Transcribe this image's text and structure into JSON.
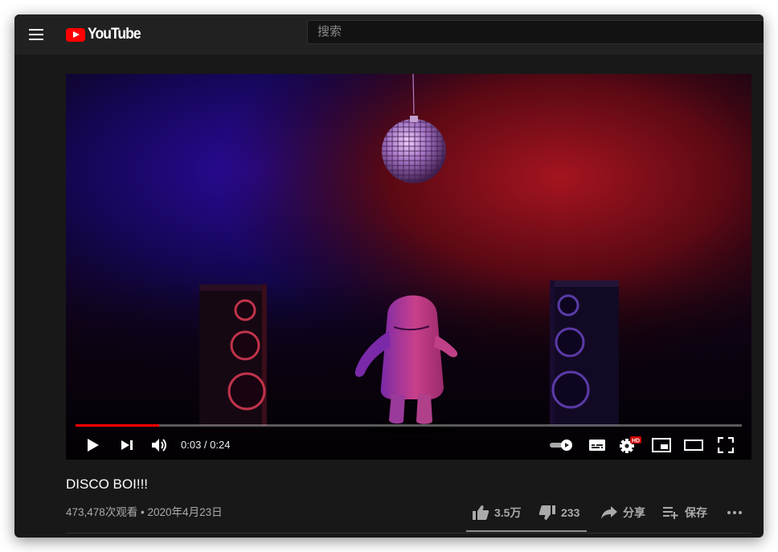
{
  "header": {
    "logo_text": "YouTube",
    "search_placeholder": "搜索"
  },
  "player": {
    "current_time": "0:03",
    "duration": "0:24",
    "time_display": "0:03 / 0:24",
    "progress_fraction": 0.125,
    "hd_badge": "HD",
    "autoplay_on": true
  },
  "video": {
    "title": "DISCO BOI!!!",
    "views": "473,478次观看",
    "separator": "•",
    "date": "2020年4月23日",
    "meta_line": "473,478次观看 • 2020年4月23日"
  },
  "actions": {
    "like_count": "3.5万",
    "dislike_count": "233",
    "share_label": "分享",
    "save_label": "保存"
  },
  "colors": {
    "accent": "#ff0000",
    "background": "#181818",
    "topbar": "#212121",
    "muted_text": "#aaaaaa"
  },
  "icons": [
    "menu-icon",
    "youtube-logo-icon",
    "play-icon",
    "next-icon",
    "volume-icon",
    "autoplay-toggle-icon",
    "subtitles-icon",
    "settings-icon",
    "miniplayer-icon",
    "theater-icon",
    "fullscreen-icon",
    "thumbs-up-icon",
    "thumbs-down-icon",
    "share-icon",
    "playlist-add-icon",
    "more-icon"
  ]
}
